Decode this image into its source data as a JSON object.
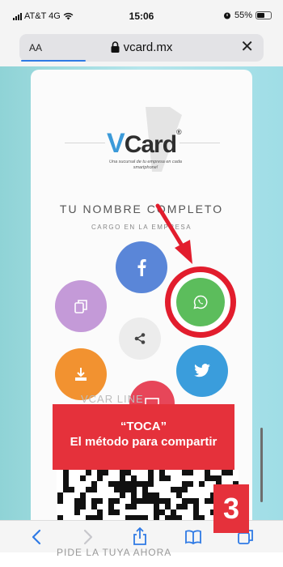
{
  "status": {
    "carrier": "AT&T 4G",
    "time": "15:06",
    "battery": "55%",
    "battery_level": 0.55
  },
  "browser": {
    "text_size_label": "AA",
    "url": "vcard.mx"
  },
  "page": {
    "logo_text": "Card",
    "logo_v": "V",
    "tagline": "Una sucursal de tu empresa en cada smartphone!",
    "name": "TU NOMBRE COMPLETO",
    "role": "CARGO EN LA EMPRESA",
    "behind_text": "VCAR  LINE",
    "bottom_text": "PIDE LA TUYA AHORA"
  },
  "overlay": {
    "instruction_line1": "“TOCA”",
    "instruction_line2": "El método para compartir",
    "step_number": "3"
  },
  "colors": {
    "accent_red": "#e5313b",
    "whatsapp_green": "#5cbd5c",
    "facebook_blue": "#5a86d8",
    "twitter_blue": "#3a9ddc"
  },
  "icons": [
    "signal-icon",
    "wifi-icon",
    "alarm-icon",
    "battery-icon",
    "lock-icon",
    "close-icon",
    "facebook-icon",
    "copy-icon",
    "share-icon",
    "download-icon",
    "twitter-icon",
    "whatsapp-icon",
    "back-icon",
    "forward-icon",
    "share-sheet-icon",
    "bookmarks-icon",
    "tabs-icon"
  ]
}
